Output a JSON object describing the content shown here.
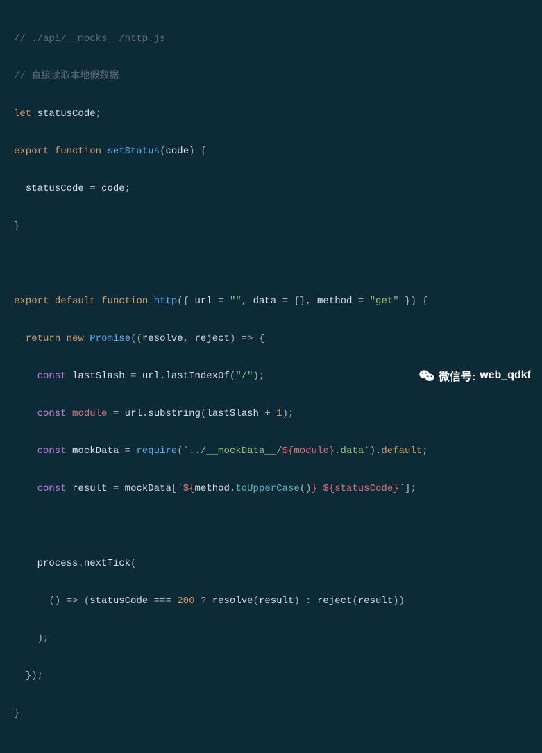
{
  "comment1": "// ./api/__mocks__/http.js",
  "comment2": "// 直接读取本地假数据",
  "kw": {
    "let": "let",
    "export": "export",
    "function": "function",
    "default": "default",
    "return": "return",
    "new": "new",
    "const": "const"
  },
  "id": {
    "statusCode": "statusCode",
    "setStatus": "setStatus",
    "code": "code",
    "http": "http",
    "url": "url",
    "data": "data",
    "method": "method",
    "Promise": "Promise",
    "resolve": "resolve",
    "reject": "reject",
    "lastSlash": "lastSlash",
    "lastIndexOf": "lastIndexOf",
    "module": "module",
    "substring": "substring",
    "mockData": "mockData",
    "require": "require",
    "result": "result",
    "toUpperCase": "toUpperCase",
    "process": "process",
    "nextTick": "nextTick"
  },
  "str": {
    "empty": "\"\"",
    "get": "\"get\"",
    "slash": "\"/\"",
    "mockPathA": "`../__mockData__/",
    "mockPathB": ".data`",
    "tmplOpen": "${",
    "tmplClose": "}",
    "btOpen": "`",
    "btClose": "`"
  },
  "num": {
    "one": "1",
    "twoHundred": "200"
  },
  "punct": {
    "sc": ";",
    "eq": " = ",
    "lp": "(",
    "rp": ")",
    "lb": "{",
    "rb": "}",
    "dot": ".",
    "comma": ", ",
    "arrow": " => ",
    "plus": " + ",
    "lbr": "[",
    "rbr": "]",
    "teq": " === ",
    "q": " ? ",
    "colon": " : ",
    "sp": " ",
    "emptyObj": "{}",
    "destructOpen": "({ ",
    "destructClose": " })"
  },
  "wm": {
    "label": "微信号:",
    "value": "web_qdkf"
  }
}
